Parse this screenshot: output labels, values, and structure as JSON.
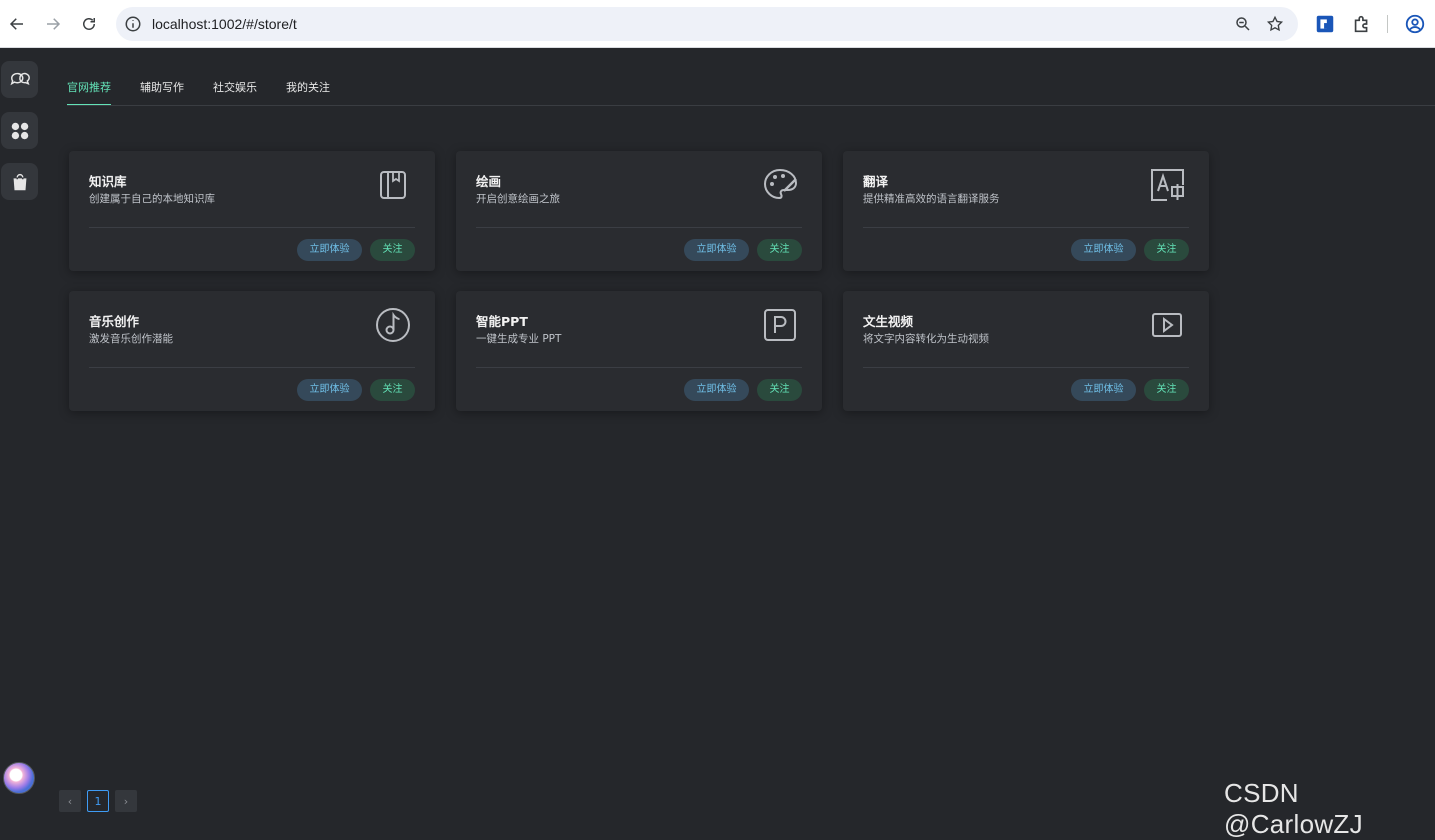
{
  "browser": {
    "url": "localhost:1002/#/store/t"
  },
  "tabs": [
    {
      "label": "官网推荐",
      "active": true
    },
    {
      "label": "辅助写作",
      "active": false
    },
    {
      "label": "社交娱乐",
      "active": false
    },
    {
      "label": "我的关注",
      "active": false
    }
  ],
  "cards": [
    {
      "title": "知识库",
      "desc": "创建属于自己的本地知识库",
      "icon": "book-icon",
      "try_label": "立即体验",
      "follow_label": "关注"
    },
    {
      "title": "绘画",
      "desc": "开启创意绘画之旅",
      "icon": "palette-icon",
      "try_label": "立即体验",
      "follow_label": "关注"
    },
    {
      "title": "翻译",
      "desc": "提供精准高效的语言翻译服务",
      "icon": "translate-icon",
      "try_label": "立即体验",
      "follow_label": "关注"
    },
    {
      "title": "音乐创作",
      "desc": "激发音乐创作潜能",
      "icon": "music-note-icon",
      "try_label": "立即体验",
      "follow_label": "关注"
    },
    {
      "title": "智能PPT",
      "desc": "一键生成专业 PPT",
      "icon": "ppt-icon",
      "try_label": "立即体验",
      "follow_label": "关注"
    },
    {
      "title": "文生视频",
      "desc": "将文字内容转化为生动视频",
      "icon": "video-play-icon",
      "try_label": "立即体验",
      "follow_label": "关注"
    }
  ],
  "pagination": {
    "prev": "‹",
    "current": "1",
    "next": "›"
  },
  "watermark": "CSDN @CarlowZJ",
  "colors": {
    "accent_green": "#63e2b7",
    "accent_blue": "#70c0e8",
    "background": "#25272b",
    "card": "#2a2c30"
  }
}
